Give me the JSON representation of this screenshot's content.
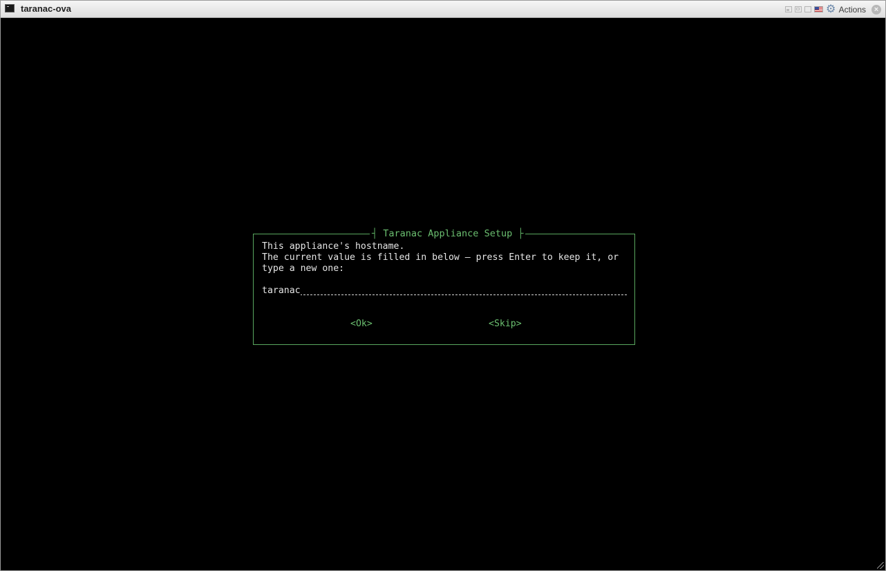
{
  "window": {
    "title": "taranac-ova",
    "actions_label": "Actions",
    "icons": [
      "console-icon",
      "fit-window-icon",
      "fit-guest-icon",
      "fullscreen-icon",
      "us-flag-icon",
      "gear-icon",
      "close-icon"
    ]
  },
  "dialog": {
    "title": "Taranac Appliance Setup",
    "lines": [
      "This appliance's hostname.",
      "The current value is filled in below — press Enter to keep it, or",
      "type a new one:"
    ],
    "input_value": "taranac",
    "ok_label": "<Ok>",
    "skip_label": "<Skip>"
  },
  "colors": {
    "console_bg": "#000000",
    "dialog_border": "#5aa85f",
    "accent_text": "#6bbf70",
    "body_text": "#e6e6e6"
  }
}
